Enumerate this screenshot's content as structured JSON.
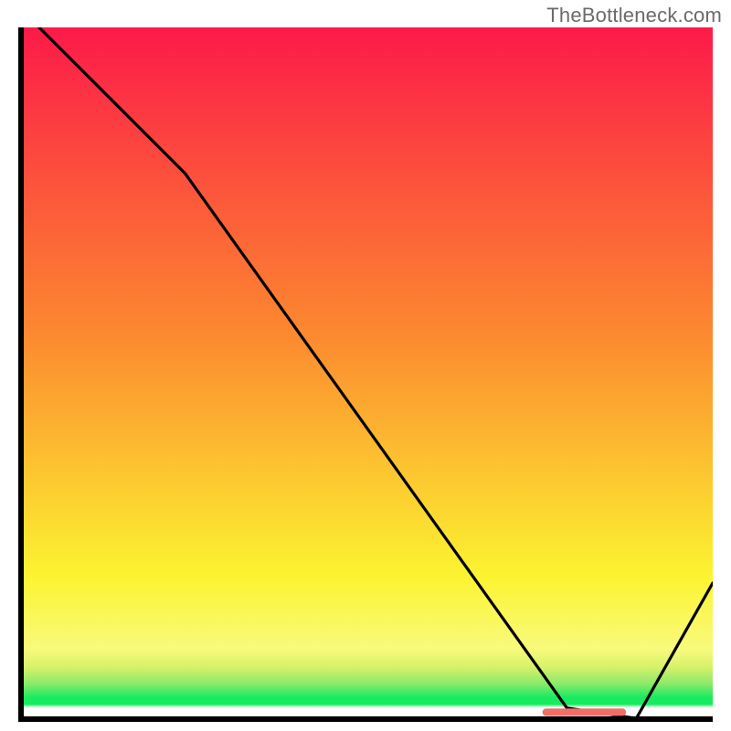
{
  "attribution": "TheBottleneck.com",
  "colors": {
    "gradient_top": "#fc1a49",
    "gradient_mid_orange": "#fc8a2f",
    "gradient_yellow": "#fcf431",
    "gradient_pale_yellow": "#f8fa7c",
    "gradient_green_band": "#18eb60",
    "axis": "#000000",
    "curve": "#000000",
    "marker": "#f36d68"
  },
  "chart_data": {
    "type": "line",
    "title": "",
    "xlabel": "",
    "ylabel": "",
    "xlim": [
      0,
      100
    ],
    "ylim": [
      0,
      100
    ],
    "curve": {
      "x": [
        3,
        24,
        79,
        89,
        100
      ],
      "y": [
        100,
        79,
        2,
        0.5,
        20
      ]
    },
    "marker_segment": {
      "x_start": 76,
      "x_end": 87,
      "y": 1.4
    },
    "background_gradient_stops": [
      {
        "pos": 0.0,
        "color": "#fc1a49"
      },
      {
        "pos": 0.45,
        "color": "#fc8a2f"
      },
      {
        "pos": 0.8,
        "color": "#fcf431"
      },
      {
        "pos": 0.905,
        "color": "#f8fa7c"
      },
      {
        "pos": 0.93,
        "color": "#d8f26a"
      },
      {
        "pos": 0.955,
        "color": "#8de96a"
      },
      {
        "pos": 0.975,
        "color": "#18eb60"
      },
      {
        "pos": 0.985,
        "color": "#18eb60"
      },
      {
        "pos": 0.99,
        "color": "#ffffff"
      },
      {
        "pos": 1.0,
        "color": "#ffffff"
      }
    ]
  }
}
